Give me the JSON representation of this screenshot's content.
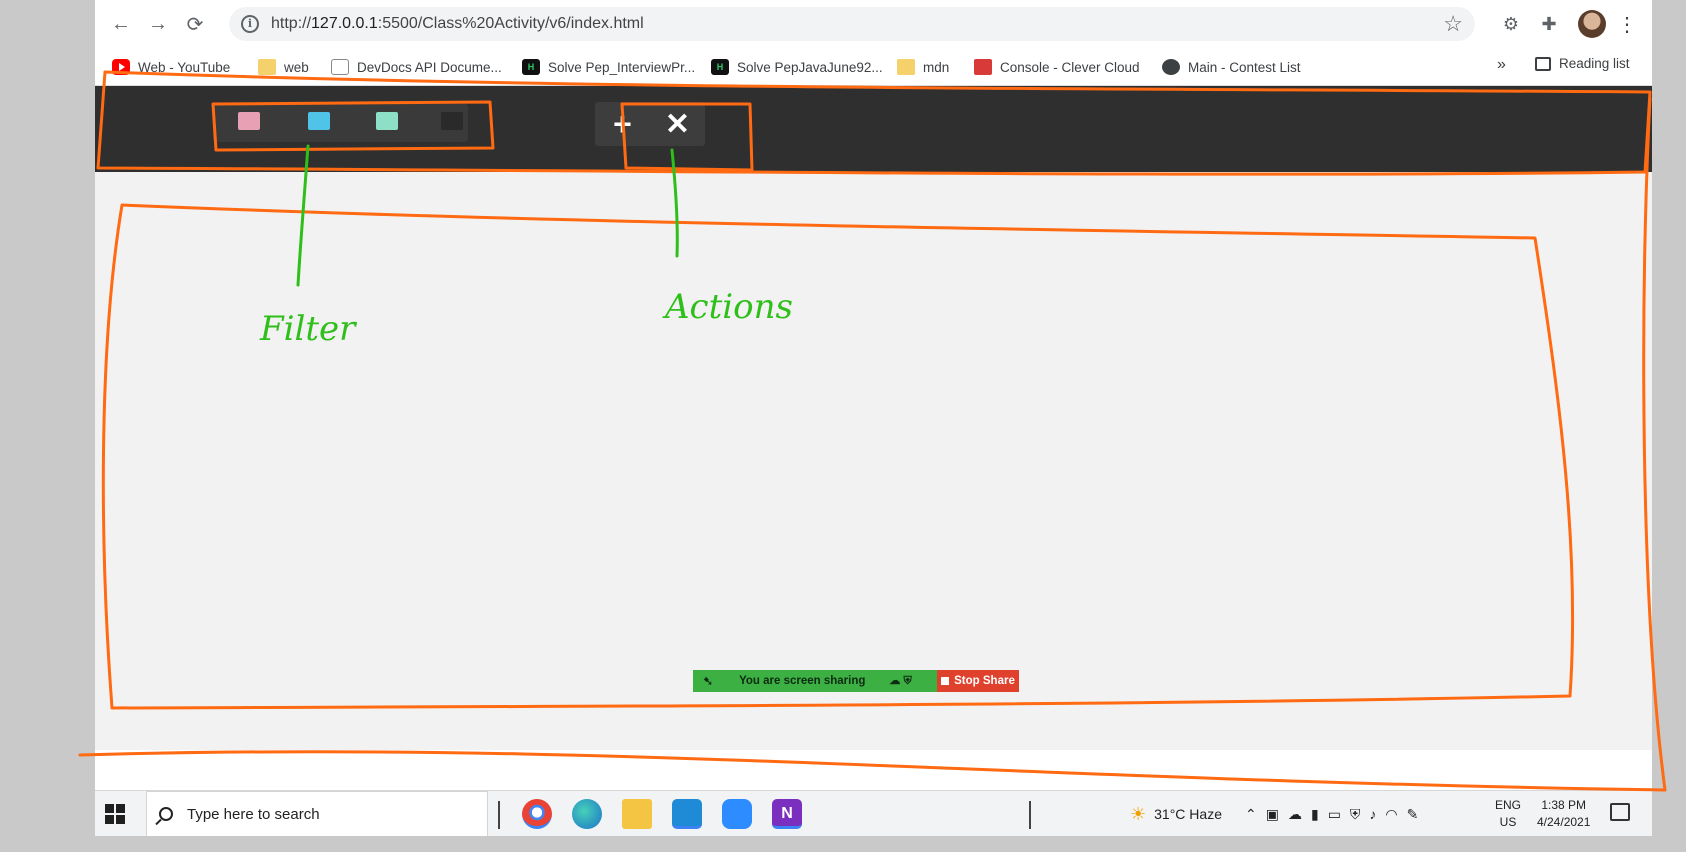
{
  "browser": {
    "nav": {
      "back_icon": "←",
      "forward_icon": "→",
      "reload_icon": "⟳"
    },
    "url": {
      "prefix": "http://",
      "host": "127.0.0.1",
      "rest": ":5500/Class%20Activity/v6/index.html"
    },
    "bookmarks": [
      {
        "label": "Web - YouTube",
        "icon": "youtube-icon"
      },
      {
        "label": "web",
        "icon": "folder-icon"
      },
      {
        "label": "DevDocs API Docume...",
        "icon": "devdocs-icon"
      },
      {
        "label": "Solve Pep_InterviewPr...",
        "icon": "hackerrank-icon"
      },
      {
        "label": "Solve PepJavaJune92...",
        "icon": "hackerrank-icon"
      },
      {
        "label": "mdn",
        "icon": "folder-icon"
      },
      {
        "label": "Console - Clever Cloud",
        "icon": "clever-cloud-icon"
      },
      {
        "label": "Main - Contest List",
        "icon": "globe-icon"
      }
    ],
    "more_label": "»",
    "reading_list_label": "Reading list"
  },
  "app": {
    "filters": [
      {
        "color": "#e8a0b4"
      },
      {
        "color": "#4fc3e8"
      },
      {
        "color": "#8de0c6"
      },
      {
        "color": "#2a2a2a"
      }
    ],
    "add_label": "+",
    "remove_label": "✕"
  },
  "annotations": {
    "filter_note": "Filter",
    "actions_note": "Actions"
  },
  "share_bar": {
    "message": "You are screen sharing",
    "stop_label": "Stop Share"
  },
  "taskbar": {
    "search_placeholder": "Type here to search",
    "weather": "31°C  Haze",
    "lang_primary": "ENG",
    "lang_secondary": "US",
    "time": "1:38 PM",
    "date": "4/24/2021"
  }
}
